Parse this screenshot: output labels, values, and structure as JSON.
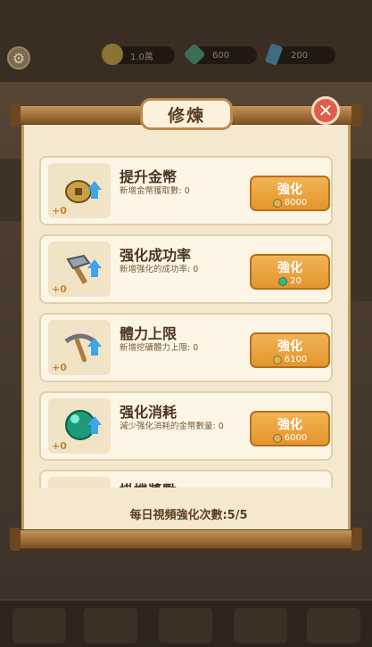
{
  "dialog": {
    "title": "修煉",
    "close_icon": "close-icon"
  },
  "top_bar": {
    "coins": "1.0萬",
    "gems": "600",
    "crystals": "200"
  },
  "items": [
    {
      "name": "提升金幣",
      "desc": "新增金幣獲取數: 0",
      "level": "+0",
      "button": "強化",
      "cost": "8000",
      "cost_type": "coin",
      "icon": "coin-icon"
    },
    {
      "name": "强化成功率",
      "desc": "新增强化的成功率: 0",
      "level": "+0",
      "button": "強化",
      "cost": "20",
      "cost_type": "gem",
      "icon": "hammer-icon"
    },
    {
      "name": "體力上限",
      "desc": "新增挖礦體力上限: 0",
      "level": "+0",
      "button": "強化",
      "cost": "6100",
      "cost_type": "coin",
      "icon": "pickaxe-icon"
    },
    {
      "name": "强化消耗",
      "desc": "減少强化消耗的金幣數量: 0",
      "level": "+0",
      "button": "強化",
      "cost": "6000",
      "cost_type": "coin",
      "icon": "orb-icon"
    },
    {
      "name": "掛機獎勵",
      "desc": "",
      "level": "",
      "button": "",
      "cost": "",
      "cost_type": "",
      "icon": ""
    }
  ],
  "footer": {
    "daily_video": "每日視頻強化次數:5/5"
  },
  "colors": {
    "button": "#e4952d",
    "panel": "#f4e9cf",
    "close": "#e25d48"
  }
}
